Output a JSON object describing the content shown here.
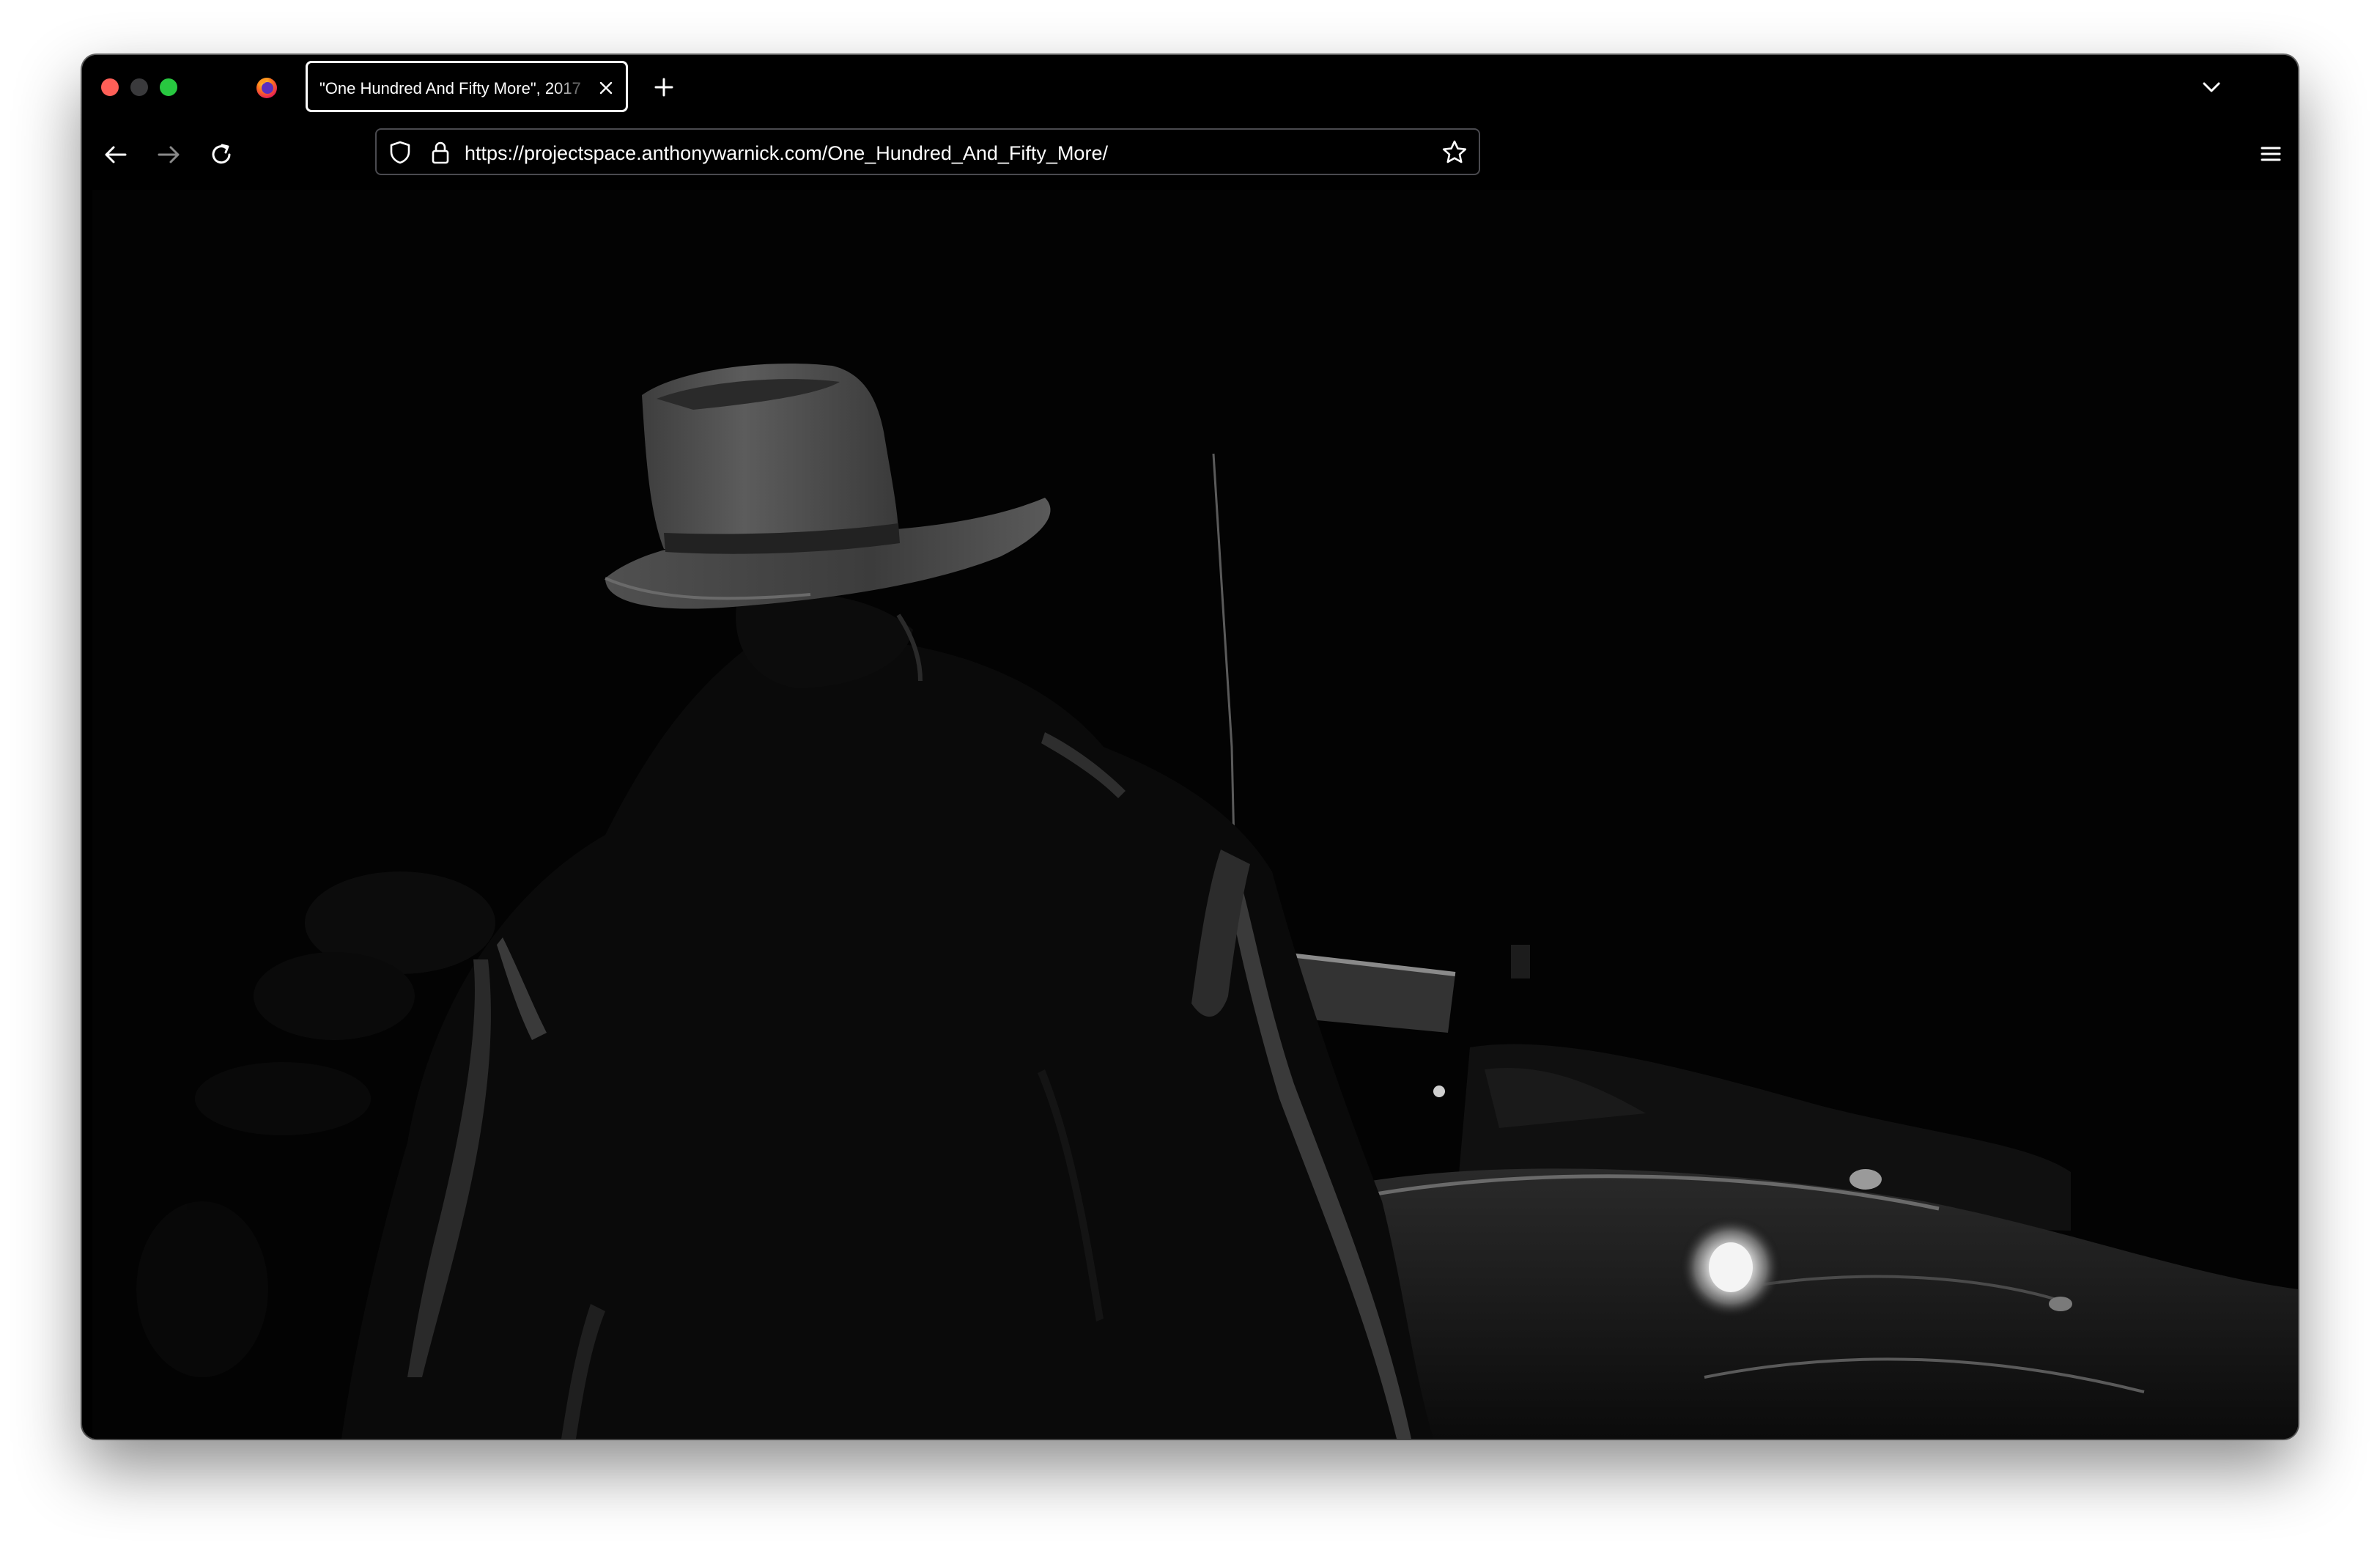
{
  "browser": {
    "window_controls": {
      "close_color": "#fe5f57",
      "minimize_color": "#3a3a3c",
      "zoom_color": "#28c840"
    },
    "tab": {
      "title": "\"One Hundred And Fifty More\", 2017"
    },
    "toolbar": {
      "url": "https://projectspace.anthonywarnick.com/One_Hundred_And_Fifty_More/"
    },
    "icons": {
      "app": "firefox-icon",
      "tab_close": "close-icon",
      "new_tab": "plus-icon",
      "tab_list": "chevron-down-icon",
      "back": "back-arrow-icon",
      "forward": "forward-arrow-icon",
      "reload": "reload-icon",
      "tracking_protection": "shield-icon",
      "secure": "lock-icon",
      "bookmark": "star-icon",
      "menu": "hamburger-menu-icon"
    },
    "forward_enabled": false
  },
  "page": {
    "media": {
      "kind": "video-still",
      "palette": "black-and-white",
      "subjects": [
        "man-in-fedora",
        "vintage-car"
      ]
    },
    "accent_colors": {
      "background": "#000000",
      "chrome_text": "#ffffff",
      "url_border": "#4a4a4f"
    }
  }
}
